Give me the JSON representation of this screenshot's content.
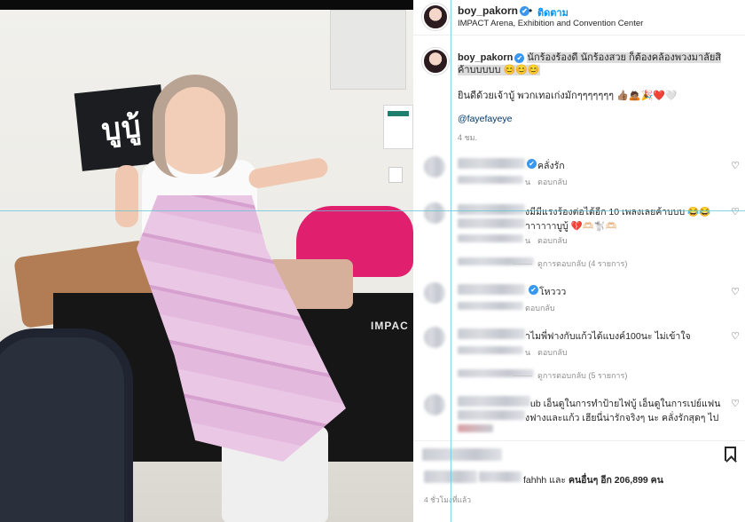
{
  "header": {
    "username": "boy_pakorn",
    "verified_badge": "✔",
    "separator": "•",
    "follow_label": "ติดตาม",
    "location": "IMPACT Arena, Exhibition and Convention Center"
  },
  "photo": {
    "sign_text": "บูบู้",
    "table_logo": "IMPAC"
  },
  "caption": {
    "username": "boy_pakorn",
    "line1": "นักร้องร้องดี นักร้องสวย ก็ต้องคล้องพวงมาลัยสิค้าบบบบบ 😊😊😊",
    "line2": "ยินดีด้วยเจ้าบู้ พวกเทอเก่งมักๆๆๆๆๆๆๆ 👍🏽🙇🏽🎉❤️🤍",
    "mention": "@fayefayeye",
    "time": "4 ชม."
  },
  "comments": [
    {
      "text": "คลั่งรัก",
      "meta_tail": "น",
      "reply_label": "ตอบกลับ",
      "has_badge": true
    },
    {
      "text": "งมีมีแรงร้องต่อได้อีก 10 เพลงเลยค้าบบบ 😂😂",
      "text2": "าาาาาาบูบู้ 💔🫶🏻🐩🫶🏻",
      "meta_tail": "น",
      "reply_label": "ตอบกลับ",
      "replies": "ดูการตอบกลับ (4 รายการ)"
    },
    {
      "text": "โหววว",
      "meta_tail": "",
      "reply_label": "ตอบกลับ",
      "has_badge": true
    },
    {
      "text": "าไมพี่ฟางกับแก้วได้แบงค์100นะ ไม่เข้าใจ",
      "meta_tail": "น",
      "reply_label": "ตอบกลับ",
      "replies": "ดูการตอบกลับ (5 รายการ)"
    },
    {
      "text": "ub เอ็นดูในการทำป้ายไฟบู้ เอ็นดูในการเปย์แฟน",
      "text2": "งฟางและแก้ว เฮียนี่น่ารักจริงๆ นะ คลั่งรักสุดๆ ไป",
      "meta_tail": "",
      "reply_label": "",
      "replies": ""
    }
  ],
  "icons": {
    "heart": "♡",
    "bookmark": "bookmark-icon"
  },
  "likes": {
    "prefix": "fahhh และ",
    "bold": "คนอื่นๆ อีก 206,899 คน"
  },
  "post_time": "4 ชั่วโมงที่แล้ว",
  "colors": {
    "accent": "#0095f6",
    "verified": "#3897f0",
    "guide_line": "#5fc6d6"
  }
}
